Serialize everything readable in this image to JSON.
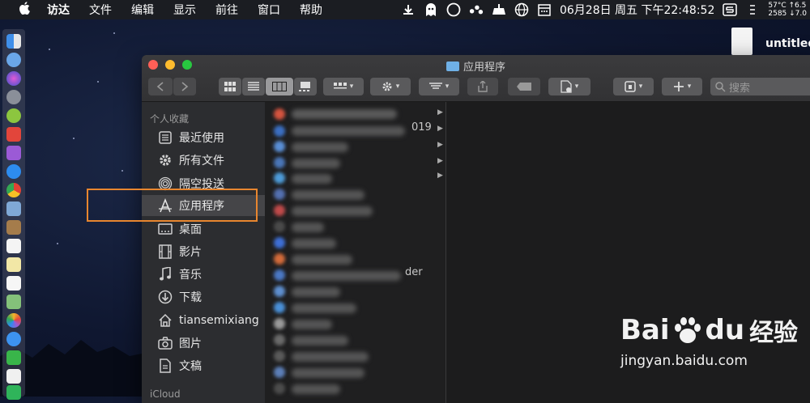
{
  "menubar": {
    "apple_icon": "apple-icon",
    "items": [
      "访达",
      "文件",
      "编辑",
      "显示",
      "前往",
      "窗口",
      "帮助"
    ],
    "date_time": "06月28日 周五 下午22:48:52",
    "stats_line1": "57°C ↑6.5",
    "stats_line2": "2585 ↓7.0",
    "status_icons": [
      "download-icon",
      "ghost-icon",
      "compass-icon",
      "cluster-icon",
      "notification-icon",
      "globe-icon",
      "calendar-icon",
      "dollar-icon"
    ]
  },
  "desktop": {
    "file_label": "untitled"
  },
  "finder": {
    "title": "应用程序",
    "search_placeholder": "搜索",
    "sidebar": {
      "section_favorites": "个人收藏",
      "items": [
        {
          "label": "最近使用",
          "icon": "recent-icon"
        },
        {
          "label": "所有文件",
          "icon": "gear-icon"
        },
        {
          "label": "隔空投送",
          "icon": "airdrop-icon"
        },
        {
          "label": "应用程序",
          "icon": "applications-icon",
          "selected": true
        },
        {
          "label": "桌面",
          "icon": "desktop-icon"
        },
        {
          "label": "影片",
          "icon": "film-icon"
        },
        {
          "label": "音乐",
          "icon": "music-icon"
        },
        {
          "label": "下载",
          "icon": "download-icon"
        },
        {
          "label": "tiansemixiang",
          "icon": "home-icon"
        },
        {
          "label": "图片",
          "icon": "camera-icon"
        },
        {
          "label": "文稿",
          "icon": "document-icon"
        }
      ],
      "section_icloud": "iCloud"
    },
    "visible_fragments": {
      "year": "019",
      "der": "der"
    }
  },
  "watermark": {
    "brand_left": "Bai",
    "brand_right": "du",
    "brand_cn": "经验",
    "url": "jingyan.baidu.com"
  },
  "colors": {
    "highlight": "#e8862f",
    "selected_row": "#454548",
    "sidebar_bg": "#2c2d30"
  }
}
